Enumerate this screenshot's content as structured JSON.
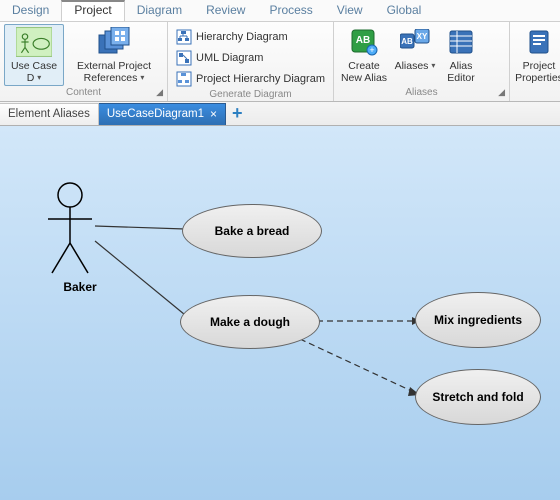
{
  "menu": {
    "items": [
      "Design",
      "Project",
      "Diagram",
      "Review",
      "Process",
      "View",
      "Global"
    ],
    "active_index": 1
  },
  "ribbon": {
    "groups": [
      {
        "label": "Content",
        "buttons": [
          {
            "name": "use-case-d",
            "label": "Use Case D",
            "selected": true,
            "dropdown": true
          },
          {
            "name": "external-project-references",
            "label": "External Project References",
            "dropdown": true
          }
        ]
      },
      {
        "label": "Generate Diagram",
        "small_items": [
          {
            "name": "hierarchy-diagram",
            "label": "Hierarchy Diagram"
          },
          {
            "name": "uml-diagram",
            "label": "UML Diagram"
          },
          {
            "name": "project-hierarchy-diagram",
            "label": "Project Hierarchy Diagram"
          }
        ]
      },
      {
        "label": "Aliases",
        "buttons": [
          {
            "name": "create-new-alias",
            "label": "Create New Alias"
          },
          {
            "name": "aliases",
            "label": "Aliases",
            "dropdown": true
          },
          {
            "name": "alias-editor",
            "label": "Alias Editor"
          }
        ]
      },
      {
        "label": "",
        "buttons": [
          {
            "name": "project-properties",
            "label": "Project Properties"
          }
        ]
      }
    ]
  },
  "tabs": {
    "items": [
      {
        "label": "Element Aliases",
        "active": false
      },
      {
        "label": "UseCaseDiagram1",
        "active": true
      }
    ]
  },
  "diagram": {
    "actor": {
      "label": "Baker"
    },
    "use_cases": [
      {
        "id": "bake",
        "label": "Bake a bread"
      },
      {
        "id": "make",
        "label": "Make a dough"
      },
      {
        "id": "mix",
        "label": "Mix ingredients"
      },
      {
        "id": "stretch",
        "label": "Stretch and fold"
      }
    ]
  }
}
